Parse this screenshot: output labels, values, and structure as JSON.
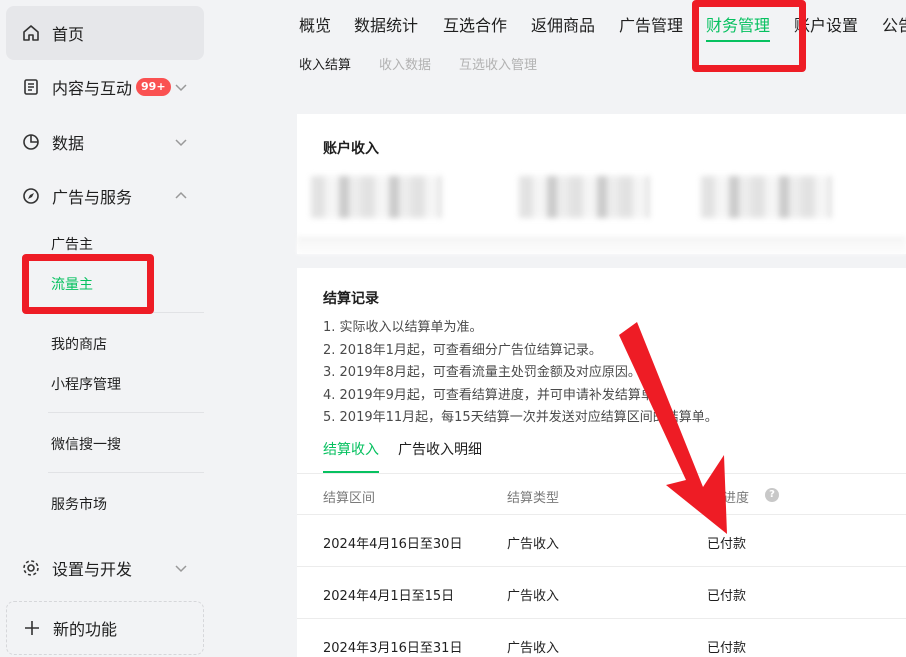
{
  "sidebar": {
    "home": "首页",
    "content": "内容与互动",
    "content_badge": "99+",
    "data": "数据",
    "ads": "广告与服务",
    "ads_sub": [
      "广告主",
      "流量主"
    ],
    "shop_items": [
      "我的商店",
      "小程序管理"
    ],
    "search": "微信搜一搜",
    "market": "服务市场",
    "settings": "设置与开发",
    "new_feature": "新的功能"
  },
  "topnav": {
    "tabs": [
      "概览",
      "数据统计",
      "互选合作",
      "返佣商品",
      "广告管理",
      "财务管理",
      "账户设置",
      "公告"
    ],
    "active_tab": "财务管理",
    "subtabs": [
      "收入结算",
      "收入数据",
      "互选收入管理"
    ]
  },
  "income_card": {
    "title": "账户收入"
  },
  "settle_card": {
    "title": "结算记录",
    "notes": [
      "1. 实际收入以结算单为准。",
      "2. 2018年1月起，可查看细分广告位结算记录。",
      "3. 2019年8月起，可查看流量主处罚金额及对应原因。",
      "4. 2019年9月起，可查看结算进度，并可申请补发结算单。",
      "5. 2019年11月起，每15天结算一次并发送对应结算区间的结算单。"
    ],
    "tabs": [
      "结算收入",
      "广告收入明细"
    ],
    "columns": [
      "结算区间",
      "结算类型",
      "结算进度"
    ],
    "rows": [
      [
        "2024年4月16日至30日",
        "广告收入",
        "已付款"
      ],
      [
        "2024年4月1日至15日",
        "广告收入",
        "已付款"
      ],
      [
        "2024年3月16日至31日",
        "广告收入",
        "已付款"
      ]
    ]
  },
  "colors": {
    "accent": "#07c160",
    "highlight": "#ee1c25",
    "badge": "#fa5151"
  }
}
